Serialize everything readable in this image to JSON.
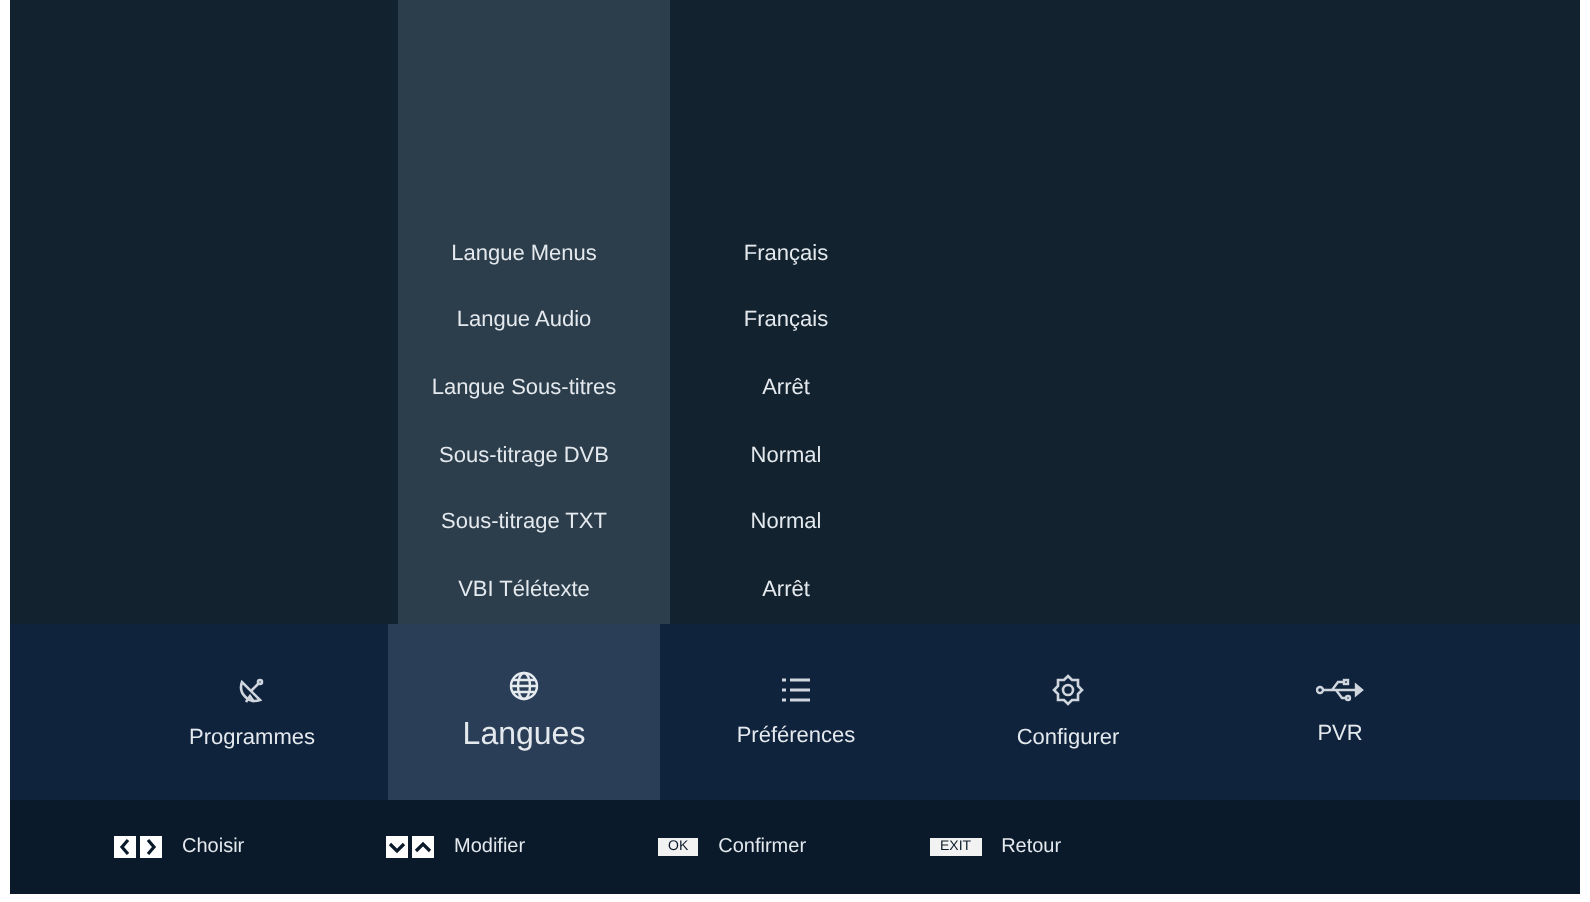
{
  "settings": [
    {
      "label": "Langue Menus",
      "value": "Français"
    },
    {
      "label": "Langue Audio",
      "value": "Français"
    },
    {
      "label": "Langue Sous-titres",
      "value": "Arrêt"
    },
    {
      "label": "Sous-titrage DVB",
      "value": "Normal"
    },
    {
      "label": "Sous-titrage TXT",
      "value": "Normal"
    },
    {
      "label": "VBI Télétexte",
      "value": "Arrêt"
    }
  ],
  "tabs": [
    {
      "label": "Programmes",
      "kind": "satellite",
      "selected": false
    },
    {
      "label": "Langues",
      "kind": "globe",
      "selected": true
    },
    {
      "label": "Préférences",
      "kind": "list",
      "selected": false
    },
    {
      "label": "Configurer",
      "kind": "gear",
      "selected": false
    },
    {
      "label": "PVR",
      "kind": "usb",
      "selected": false
    }
  ],
  "hints": [
    {
      "kind": "left-right",
      "label": "Choisir"
    },
    {
      "kind": "down-up",
      "label": "Modifier"
    },
    {
      "kind": "key",
      "key": "OK",
      "label": "Confirmer"
    },
    {
      "kind": "key",
      "key": "EXIT",
      "label": "Retour"
    }
  ]
}
